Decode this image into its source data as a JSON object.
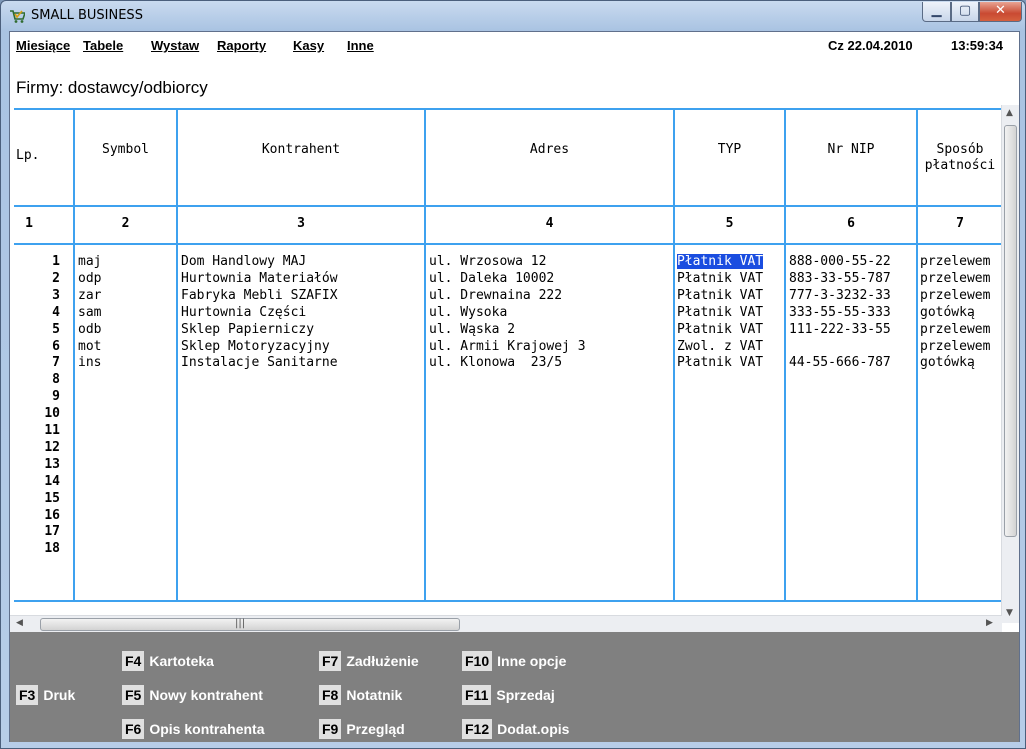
{
  "window": {
    "title": "SMALL BUSINESS"
  },
  "menu": {
    "items": [
      "Miesiące",
      "Tabele",
      "Wystaw",
      "Raporty",
      "Kasy",
      "Inne"
    ],
    "date": "Cz 22.04.2010",
    "time": "13:59:34"
  },
  "section_title": "Firmy: dostawcy/odbiorcy",
  "table": {
    "headers": [
      "Lp.",
      "Symbol",
      "Kontrahent",
      "Adres",
      "TYP",
      "Nr NIP",
      "Sposób\npłatności"
    ],
    "column_numbers": [
      "1",
      "2",
      "3",
      "4",
      "5",
      "6",
      "7"
    ],
    "rows": [
      {
        "lp": "1",
        "symbol": "maj",
        "kontrahent": "Dom Handlowy MAJ",
        "adres": "ul. Wrzosowa 12",
        "typ": "Płatnik VAT",
        "nip": "888-000-55-22",
        "platnosc": "przelewem"
      },
      {
        "lp": "2",
        "symbol": "odp",
        "kontrahent": "Hurtownia Materiałów",
        "adres": "ul. Daleka 10002",
        "typ": "Płatnik VAT",
        "nip": "883-33-55-787",
        "platnosc": "przelewem"
      },
      {
        "lp": "3",
        "symbol": "zar",
        "kontrahent": "Fabryka Mebli SZAFIX",
        "adres": "ul. Drewnaina 222",
        "typ": "Płatnik VAT",
        "nip": "777-3-3232-33",
        "platnosc": "przelewem"
      },
      {
        "lp": "4",
        "symbol": "sam",
        "kontrahent": "Hurtownia Części",
        "adres": "ul. Wysoka",
        "typ": "Płatnik VAT",
        "nip": "333-55-55-333",
        "platnosc": "gotówką"
      },
      {
        "lp": "5",
        "symbol": "odb",
        "kontrahent": "Sklep Papierniczy",
        "adres": "ul. Wąska 2",
        "typ": "Płatnik VAT",
        "nip": "111-222-33-55",
        "platnosc": "przelewem"
      },
      {
        "lp": "6",
        "symbol": "mot",
        "kontrahent": "Sklep Motoryzacyjny",
        "adres": "ul. Armii Krajowej 3",
        "typ": "Zwol. z VAT",
        "nip": "",
        "platnosc": "przelewem"
      },
      {
        "lp": "7",
        "symbol": "ins",
        "kontrahent": "Instalacje Sanitarne",
        "adres": "ul. Klonowa  23/5",
        "typ": "Płatnik VAT",
        "nip": "44-55-666-787",
        "platnosc": "gotówką"
      },
      {
        "lp": "8"
      },
      {
        "lp": "9"
      },
      {
        "lp": "10"
      },
      {
        "lp": "11"
      },
      {
        "lp": "12"
      },
      {
        "lp": "13"
      },
      {
        "lp": "14"
      },
      {
        "lp": "15"
      },
      {
        "lp": "16"
      },
      {
        "lp": "17"
      },
      {
        "lp": "18"
      }
    ],
    "selected": {
      "row": 0,
      "column": "typ"
    }
  },
  "fn_keys": [
    {
      "key": "F3",
      "label": "Druk"
    },
    {
      "key": "F4",
      "label": "Kartoteka"
    },
    {
      "key": "F5",
      "label": "Nowy kontrahent"
    },
    {
      "key": "F6",
      "label": "Opis kontrahenta"
    },
    {
      "key": "F7",
      "label": "Zadłużenie"
    },
    {
      "key": "F8",
      "label": "Notatnik"
    },
    {
      "key": "F9",
      "label": "Przegląd"
    },
    {
      "key": "F10",
      "label": "Inne opcje"
    },
    {
      "key": "F11",
      "label": "Sprzedaj"
    },
    {
      "key": "F12",
      "label": "Dodat.opis"
    }
  ],
  "icons": {
    "app": "shopping-cart-icon",
    "minimize": "minimize-icon",
    "maximize": "maximize-icon",
    "close": "close-icon"
  },
  "colors": {
    "grid_lines": "#3ea1ef",
    "selection": "#1a4de0",
    "fn_bar": "#808080"
  }
}
